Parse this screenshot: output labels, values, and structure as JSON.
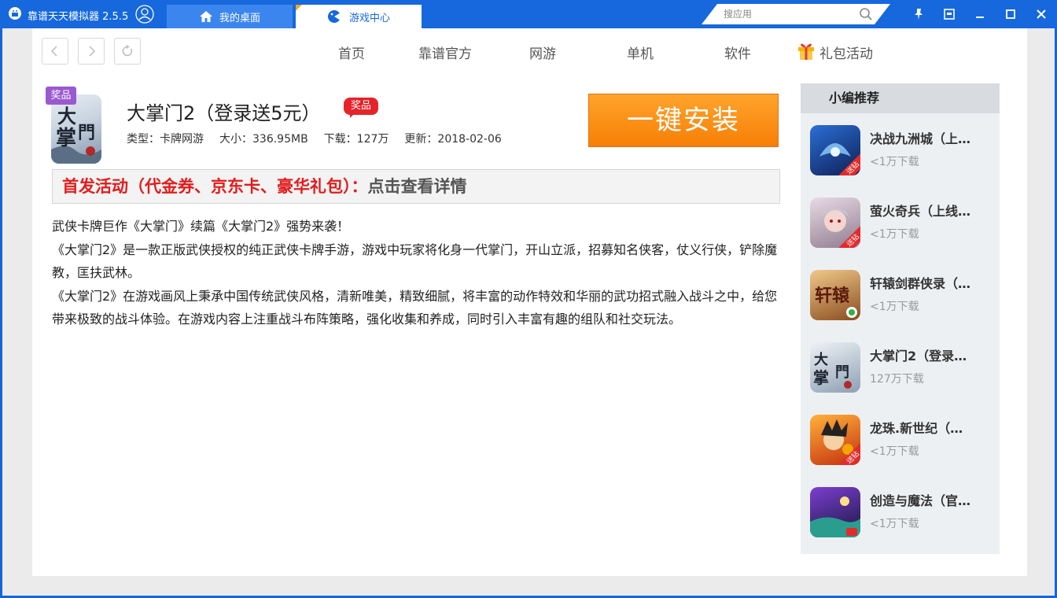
{
  "titlebar": {
    "app_title": "靠谱天天模拟器 2.5.5",
    "tabs": [
      {
        "label": "我的桌面",
        "icon": "home-icon"
      },
      {
        "label": "游戏中心",
        "icon": "gamepad-icon"
      }
    ],
    "search_placeholder": "搜应用",
    "window_buttons": [
      "pin-icon",
      "restore-mini-icon",
      "minimize-icon",
      "maximize-icon",
      "close-icon"
    ]
  },
  "nav": {
    "menu": [
      "首页",
      "靠谱官方",
      "网游",
      "单机",
      "软件",
      "礼包活动"
    ]
  },
  "app": {
    "prize_badge": "奖品",
    "name": "大掌门2（登录送5元）",
    "red_badge": "奖品",
    "type": "类型：卡牌网游",
    "size": "大小：336.95MB",
    "downloads": "下载：127万",
    "updated": "更新：2018-02-06",
    "install_label": "一键安装",
    "icon_text": "大掌門"
  },
  "promo": {
    "red_text": "首发活动（代金券、京东卡、豪华礼包）：",
    "gray_text": "点击查看详情"
  },
  "description": [
    "武侠卡牌巨作《大掌门》续篇《大掌门2》强势来袭！",
    "《大掌门2》是一款正版武侠授权的纯正武侠卡牌手游，游戏中玩家将化身一代掌门，开山立派，招募知名侠客，仗义行侠，铲除魔教，匡扶武林。",
    "《大掌门2》在游戏画风上秉承中国传统武侠风格，清新唯美，精致细腻，将丰富的动作特效和华丽的武功招式融入战斗之中，给您带来极致的战斗体验。在游戏内容上注重战斗布阵策略，强化收集和养成，同时引入丰富有趣的组队和社交玩法。"
  ],
  "sidebar": {
    "title": "小编推荐",
    "items": [
      {
        "title": "决战九洲城（上…",
        "sub": "<1万下载",
        "tag": "送钻",
        "color": "#1d3f8c"
      },
      {
        "title": "萤火奇兵（上线…",
        "sub": "<1万下载",
        "tag": "送钻",
        "color": "#c9b7c0"
      },
      {
        "title": "轩辕剑群侠录（…",
        "sub": "<1万下载",
        "tag": "",
        "color": "#b07a3b"
      },
      {
        "title": "大掌门2（登录…",
        "sub": "127万下载",
        "tag": "",
        "color": "#a9b8c8"
      },
      {
        "title": "龙珠.新世纪（…",
        "sub": "<1万下载",
        "tag": "送钻",
        "color": "#e05a1c"
      },
      {
        "title": "创造与魔法（官…",
        "sub": "<1万下载",
        "tag": "",
        "color": "#3b2a6b"
      }
    ]
  }
}
